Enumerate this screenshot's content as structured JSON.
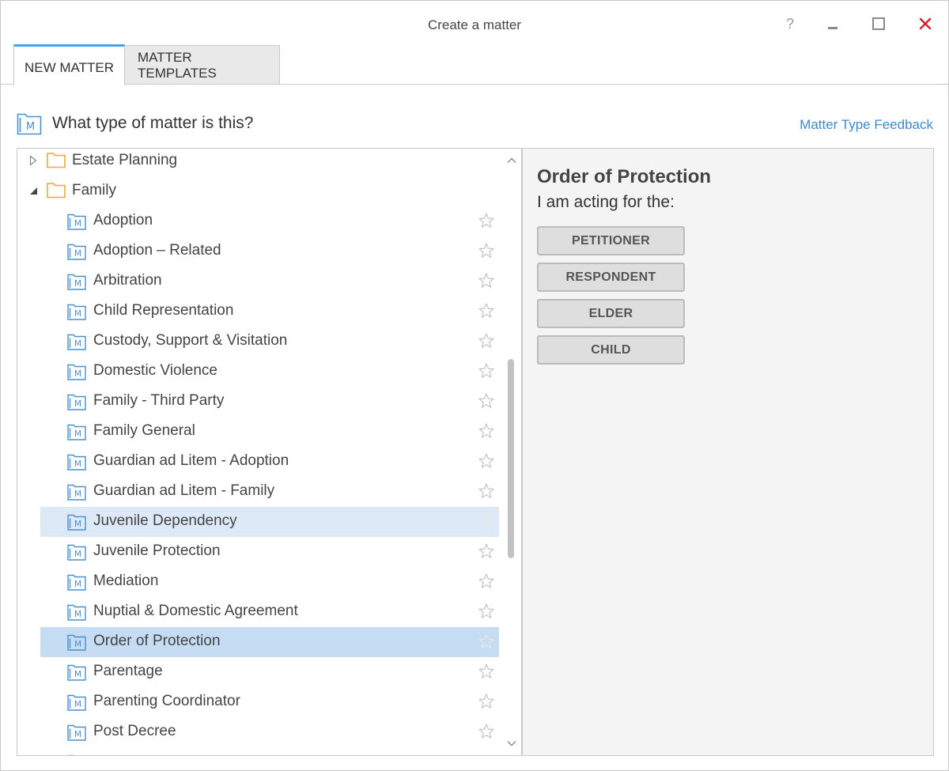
{
  "window": {
    "title": "Create a matter",
    "help_label": "?"
  },
  "tabs": [
    {
      "label": "NEW MATTER",
      "active": true
    },
    {
      "label": "MATTER TEMPLATES",
      "active": false
    }
  ],
  "heading": {
    "question": "What type of matter is this?",
    "feedback_link": "Matter Type Feedback"
  },
  "tree": {
    "folders": [
      {
        "label": "Estate Planning",
        "expanded": false
      },
      {
        "label": "Family",
        "expanded": true
      }
    ],
    "items": [
      {
        "label": "Adoption",
        "state": ""
      },
      {
        "label": "Adoption – Related",
        "state": ""
      },
      {
        "label": "Arbitration",
        "state": ""
      },
      {
        "label": "Child Representation",
        "state": ""
      },
      {
        "label": "Custody, Support & Visitation",
        "state": ""
      },
      {
        "label": "Domestic Violence",
        "state": ""
      },
      {
        "label": "Family - Third Party",
        "state": ""
      },
      {
        "label": "Family General",
        "state": ""
      },
      {
        "label": "Guardian ad Litem - Adoption",
        "state": ""
      },
      {
        "label": "Guardian ad Litem - Family",
        "state": ""
      },
      {
        "label": "Juvenile Dependency",
        "state": "hover"
      },
      {
        "label": "Juvenile Protection",
        "state": ""
      },
      {
        "label": "Mediation",
        "state": ""
      },
      {
        "label": "Nuptial & Domestic Agreement",
        "state": ""
      },
      {
        "label": "Order of Protection",
        "state": "selected"
      },
      {
        "label": "Parentage",
        "state": ""
      },
      {
        "label": "Parenting Coordinator",
        "state": ""
      },
      {
        "label": "Post Decree",
        "state": ""
      }
    ]
  },
  "detail": {
    "title": "Order of Protection",
    "subtitle": "I am acting for the:",
    "roles": [
      "PETITIONER",
      "RESPONDENT",
      "ELDER",
      "CHILD"
    ]
  },
  "colors": {
    "accent": "#4aa3df",
    "link": "#3d8ad0",
    "folder": "#f0a830",
    "matter_icon": "#4a8fd0",
    "close": "#d0202a",
    "selected_row": "#c5dcf3",
    "hover_row": "#dde9f7"
  }
}
